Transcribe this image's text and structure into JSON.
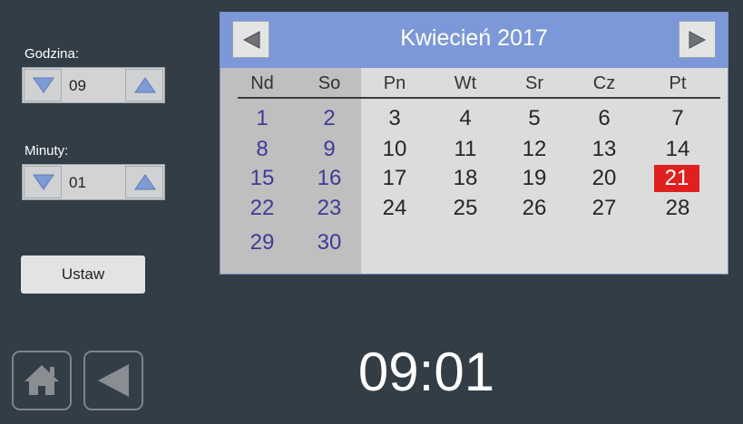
{
  "time_panel": {
    "hour_label": "Godzina:",
    "hour_value": "09",
    "minute_label": "Minuty:",
    "minute_value": "01",
    "set_button_label": "Ustaw"
  },
  "calendar": {
    "title": "Kwiecień 2017",
    "weekdays": [
      "Nd",
      "So",
      "Pn",
      "Wt",
      "Sr",
      "Cz",
      "Pt"
    ],
    "rows": [
      [
        "1",
        "2",
        "3",
        "4",
        "5",
        "6",
        "7"
      ],
      [
        "8",
        "9",
        "10",
        "11",
        "12",
        "13",
        "14"
      ],
      [
        "15",
        "16",
        "17",
        "18",
        "19",
        "20",
        "21"
      ],
      [
        "22",
        "23",
        "24",
        "25",
        "26",
        "27",
        "28"
      ],
      [
        "29",
        "30"
      ]
    ],
    "selected_day": "21"
  },
  "clock": {
    "display": "09:01"
  },
  "colors": {
    "background": "#323d46",
    "header": "#7c98d8",
    "weekend_text": "#3e3b95",
    "selected": "#e02020"
  },
  "icons": {
    "home": "home-icon",
    "back": "back-arrow-icon",
    "prev_month": "arrow-left-icon",
    "next_month": "arrow-right-icon",
    "up": "arrow-up-icon",
    "down": "arrow-down-icon"
  }
}
